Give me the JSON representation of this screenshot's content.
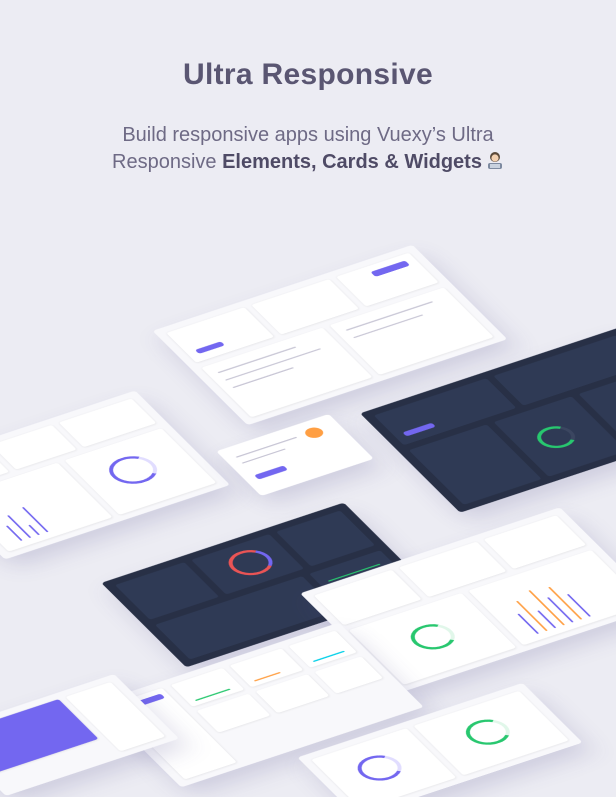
{
  "hero": {
    "title": "Ultra Responsive",
    "subtitle_line1": "Build responsive apps using Vuexy’s Ultra",
    "subtitle_line2_plain": "Responsive ",
    "subtitle_line2_bold": "Elements, Cards & Widgets"
  },
  "colors": {
    "background": "#ececf3",
    "accent": "#7367f0",
    "dark_panel": "#283046",
    "success": "#28c76f",
    "warning": "#ff9f43",
    "danger": "#ea5455"
  },
  "icons": {
    "emoji": "woman-technologist-icon"
  }
}
